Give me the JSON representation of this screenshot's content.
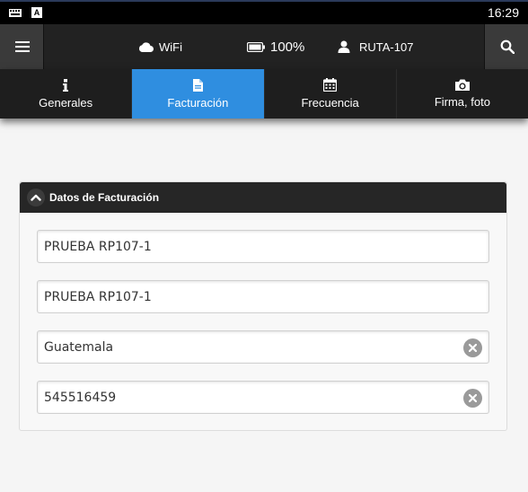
{
  "status_bar": {
    "time": "16:29",
    "a_icon_label": "A"
  },
  "app_bar": {
    "connection": "WiFi",
    "battery": "100%",
    "user": "RUTA-107"
  },
  "tabs": [
    {
      "label": "Generales",
      "icon": "info-icon",
      "active": false
    },
    {
      "label": "Facturación",
      "icon": "document-icon",
      "active": true
    },
    {
      "label": "Frecuencia",
      "icon": "calendar-icon",
      "active": false
    },
    {
      "label": "Firma, foto",
      "icon": "camera-icon",
      "active": false
    }
  ],
  "billing": {
    "title": "Datos de Facturación",
    "fields": [
      {
        "value": "PRUEBA RP107-1",
        "clearable": false
      },
      {
        "value": "PRUEBA RP107-1",
        "clearable": false
      },
      {
        "value": "Guatemala",
        "clearable": true
      },
      {
        "value": "545516459",
        "clearable": true
      }
    ]
  },
  "colors": {
    "accent": "#2f8ee0",
    "app_bar": "#222222",
    "tab_bar": "#1e1e1e"
  }
}
